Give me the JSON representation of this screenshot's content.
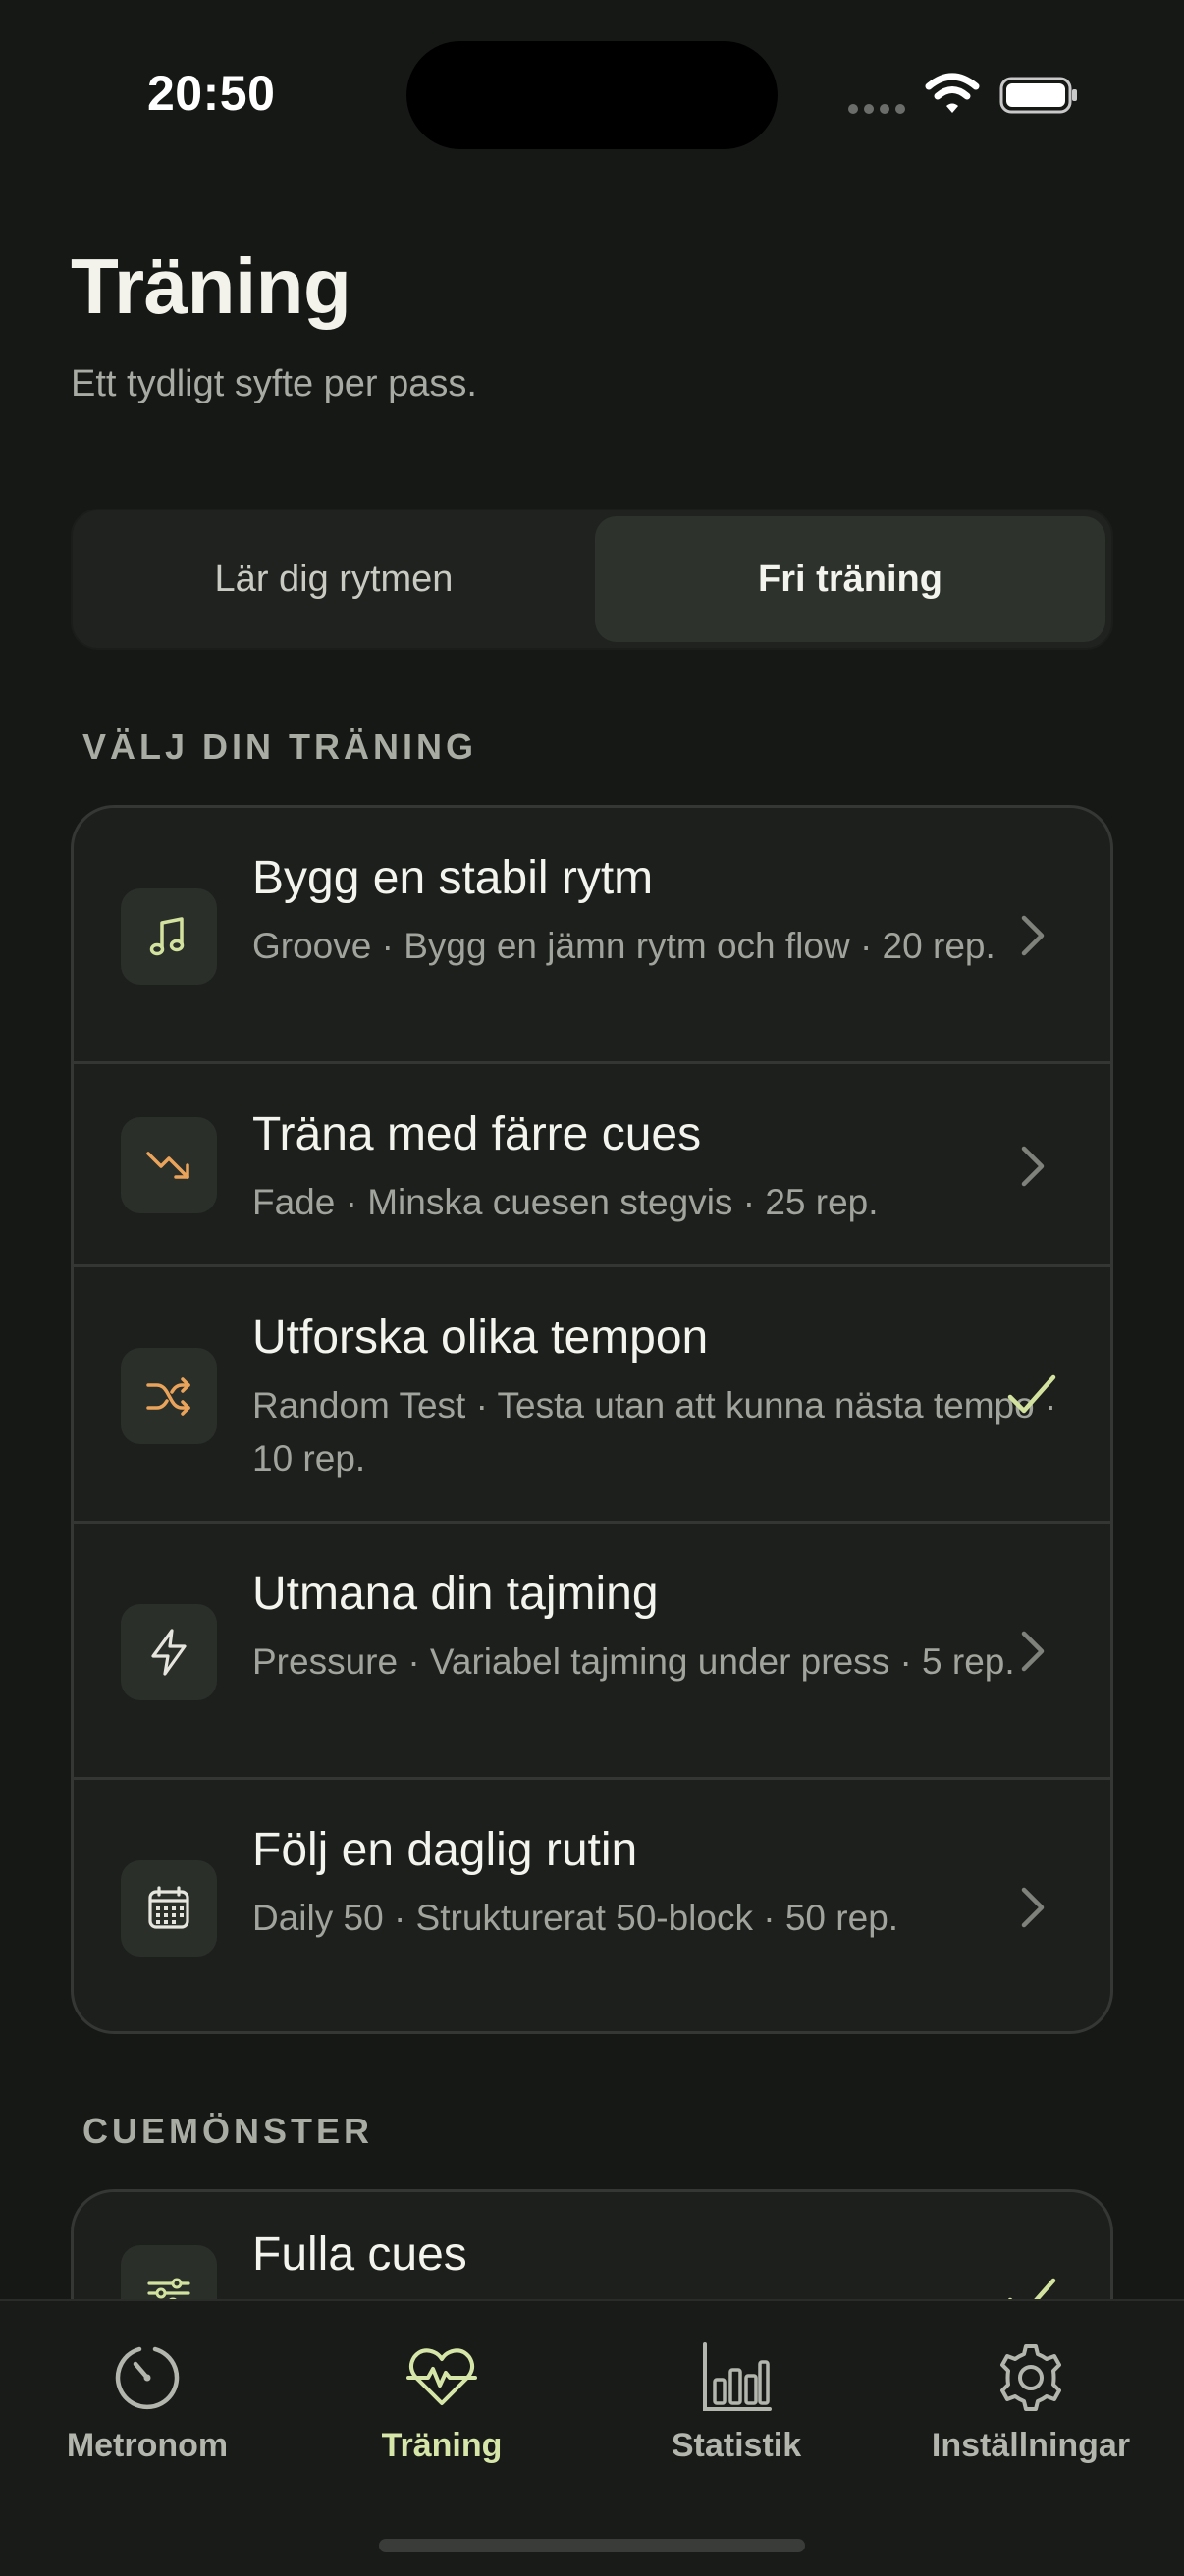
{
  "status_bar": {
    "time": "20:50"
  },
  "header": {
    "title": "Träning",
    "subtitle": "Ett tydligt syfte per pass."
  },
  "segmented": {
    "left": "Lär dig rytmen",
    "right": "Fri träning",
    "selected": "right"
  },
  "training": {
    "section_title": "VÄLJ DIN TRÄNING",
    "items": [
      {
        "title": "Bygg en stabil rytm",
        "desc": "Groove · Bygg en jämn rytm och flow · 20 rep.",
        "icon": "music-note-icon",
        "trailing": "chevron"
      },
      {
        "title": "Träna med färre cues",
        "desc": "Fade · Minska cuesen stegvis · 25 rep.",
        "icon": "trend-down-icon",
        "trailing": "chevron"
      },
      {
        "title": "Utforska olika tempon",
        "desc": "Random Test · Testa utan att kunna nästa tempo · 10 rep.",
        "icon": "shuffle-icon",
        "trailing": "check"
      },
      {
        "title": "Utmana din tajming",
        "desc": "Pressure · Variabel tajming under press · 5 rep.",
        "icon": "lightning-icon",
        "trailing": "chevron"
      },
      {
        "title": "Följ en daglig rutin",
        "desc": "Daily 50 · Strukturerat 50-block · 50 rep.",
        "icon": "calendar-icon",
        "trailing": "chevron"
      }
    ]
  },
  "cue_patterns": {
    "section_title": "CUEMÖNSTER",
    "items": [
      {
        "title": "Fulla cues",
        "icon": "sliders-icon",
        "trailing": "check"
      }
    ]
  },
  "tabbar": {
    "tabs": [
      {
        "label": "Metronom",
        "icon": "gauge-icon"
      },
      {
        "label": "Träning",
        "icon": "heart-pulse-icon",
        "active": true
      },
      {
        "label": "Statistik",
        "icon": "bar-chart-icon"
      },
      {
        "label": "Inställningar",
        "icon": "gear-icon"
      }
    ]
  },
  "colors": {
    "background": "#161816",
    "accent": "#d6e6a8",
    "icon_orange": "#e9a35a",
    "icon_green": "#d4e2a0"
  }
}
